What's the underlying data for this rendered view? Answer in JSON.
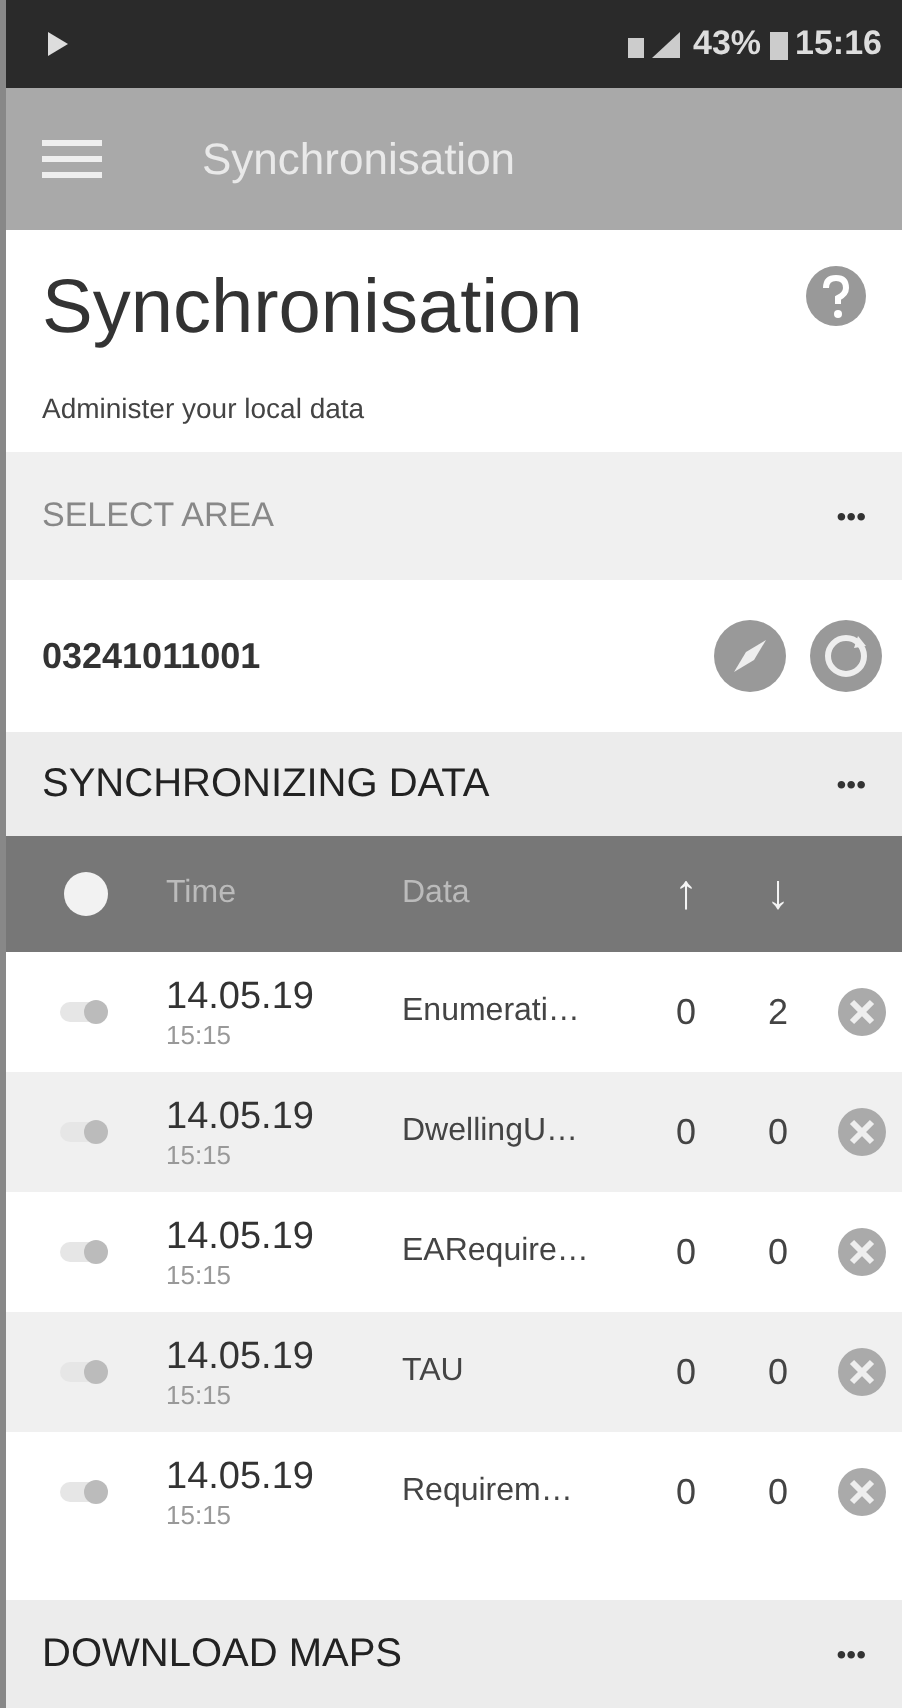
{
  "status_bar": {
    "battery": "43%",
    "time": "15:16"
  },
  "app_bar": {
    "title": "Synchronisation"
  },
  "header": {
    "title": "Synchronisation",
    "subtitle": "Administer your local data"
  },
  "select_area": {
    "label": "SELECT AREA",
    "more": "•••",
    "area_code": "03241011001"
  },
  "sync_section": {
    "label": "SYNCHRONIZING DATA",
    "more": "•••"
  },
  "table": {
    "columns": [
      "Time",
      "Data",
      "↑",
      "↓"
    ],
    "rows": [
      {
        "date": "14.05.19",
        "time": "15:15",
        "data": "Enumerati…",
        "up": "0",
        "down": "2"
      },
      {
        "date": "14.05.19",
        "time": "15:15",
        "data": "DwellingU…",
        "up": "0",
        "down": "0"
      },
      {
        "date": "14.05.19",
        "time": "15:15",
        "data": "EARequire…",
        "up": "0",
        "down": "0"
      },
      {
        "date": "14.05.19",
        "time": "15:15",
        "data": "TAU",
        "up": "0",
        "down": "0"
      },
      {
        "date": "14.05.19",
        "time": "15:15",
        "data": "Requirem…",
        "up": "0",
        "down": "0"
      }
    ]
  },
  "footer_section": {
    "label": "DOWNLOAD MAPS",
    "more": "•••"
  }
}
